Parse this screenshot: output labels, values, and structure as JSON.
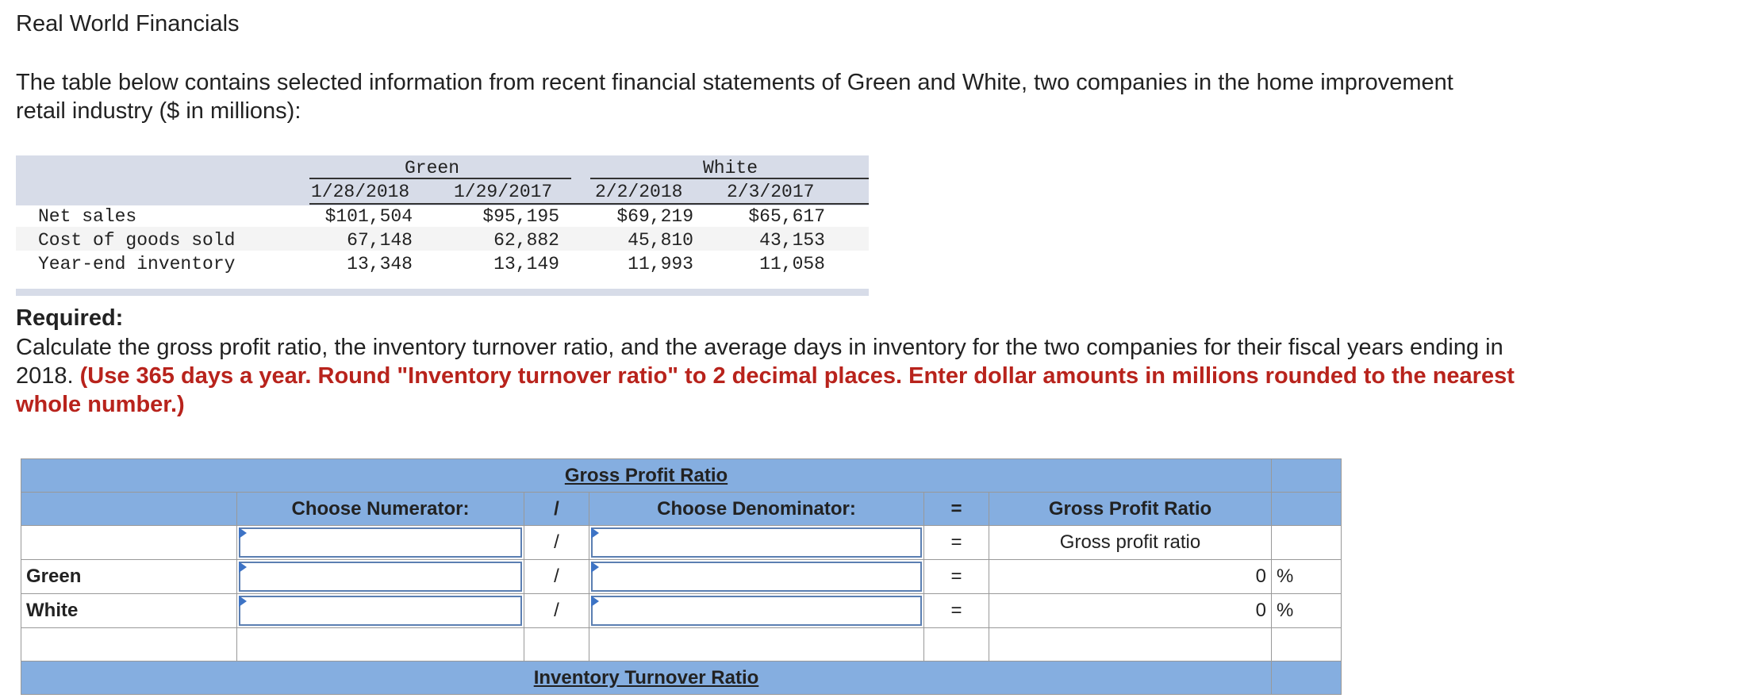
{
  "title": "Real World Financials",
  "intro": "The table below contains selected information from recent financial statements of Green and White, two companies in the home improvement retail industry ($ in millions):",
  "financials": {
    "company_green": "Green",
    "company_white": "White",
    "dates": [
      "1/28/2018",
      "1/29/2017",
      "2/2/2018",
      "2/3/2017"
    ],
    "rows": [
      {
        "label": "Net sales",
        "values": [
          "$101,504",
          "$95,195",
          "$69,219",
          "$65,617"
        ]
      },
      {
        "label": "Cost of goods sold",
        "values": [
          "67,148",
          "62,882",
          "45,810",
          "43,153"
        ]
      },
      {
        "label": "Year-end inventory",
        "values": [
          "13,348",
          "13,149",
          "11,993",
          "11,058"
        ]
      }
    ]
  },
  "required_heading": "Required:",
  "required_text": "Calculate the gross profit ratio, the inventory turnover ratio, and the average days in inventory for the two companies for their fiscal years ending in 2018.",
  "required_note": "(Use 365 days a year. Round \"Inventory turnover ratio\" to 2 decimal places. Enter dollar amounts in millions rounded to the nearest whole number.)",
  "worksheet": {
    "gross_title": "Gross Profit Ratio",
    "numerator_header": "Choose Numerator:",
    "slash": "/",
    "denominator_header": "Choose Denominator:",
    "equals": "=",
    "result_header": "Gross Profit Ratio",
    "result_label": "Gross profit ratio",
    "rows": [
      {
        "company": "Green",
        "value": "0",
        "unit": "%"
      },
      {
        "company": "White",
        "value": "0",
        "unit": "%"
      }
    ],
    "inventory_title": "Inventory Turnover Ratio"
  }
}
